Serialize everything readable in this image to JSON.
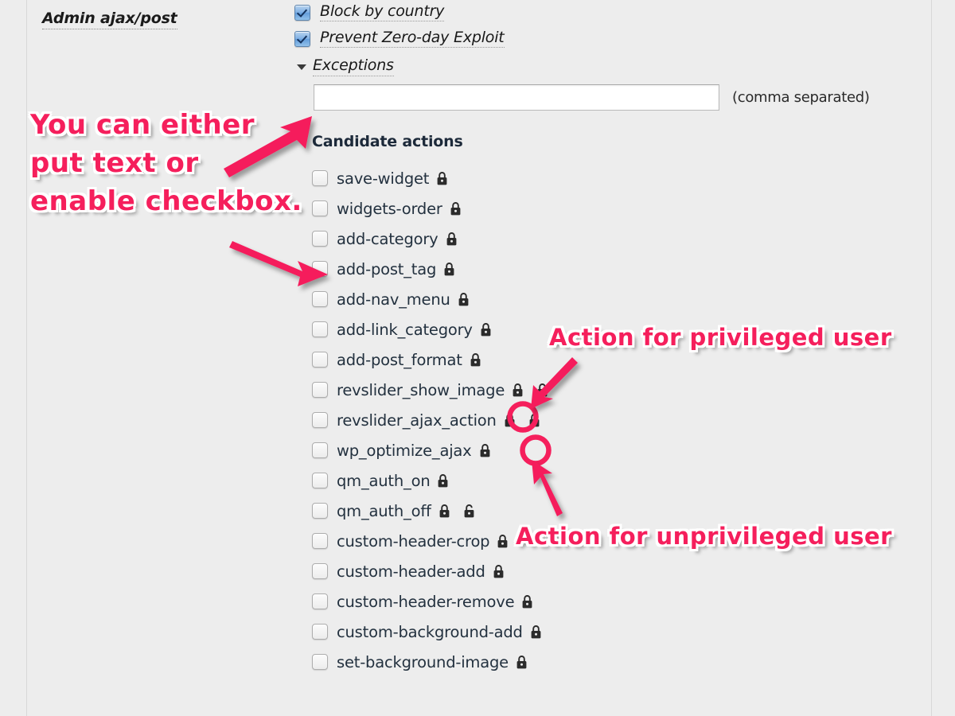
{
  "section": {
    "row_label": "Admin ajax/post"
  },
  "toggles": [
    {
      "label": "Block by country",
      "checked": true,
      "icon": "checkbox-checked-icon"
    },
    {
      "label": "Prevent Zero-day Exploit",
      "checked": true,
      "icon": "checkbox-checked-icon"
    }
  ],
  "exceptions": {
    "disclosure_icon": "triangle-down-icon",
    "label": "Exceptions",
    "value": "",
    "placeholder": "",
    "hint": "(comma separated)"
  },
  "candidate_actions": {
    "heading": "Candidate actions",
    "items": [
      {
        "label": "save-widget",
        "checked": false,
        "locks": [
          "closed"
        ]
      },
      {
        "label": "widgets-order",
        "checked": false,
        "locks": [
          "closed"
        ]
      },
      {
        "label": "add-category",
        "checked": false,
        "locks": [
          "closed"
        ]
      },
      {
        "label": "add-post_tag",
        "checked": false,
        "locks": [
          "closed"
        ]
      },
      {
        "label": "add-nav_menu",
        "checked": false,
        "locks": [
          "closed"
        ]
      },
      {
        "label": "add-link_category",
        "checked": false,
        "locks": [
          "closed"
        ]
      },
      {
        "label": "add-post_format",
        "checked": false,
        "locks": [
          "closed"
        ]
      },
      {
        "label": "revslider_show_image",
        "checked": false,
        "locks": [
          "closed",
          "open"
        ]
      },
      {
        "label": "revslider_ajax_action",
        "checked": false,
        "locks": [
          "closed",
          "open"
        ]
      },
      {
        "label": "wp_optimize_ajax",
        "checked": false,
        "locks": [
          "closed"
        ]
      },
      {
        "label": "qm_auth_on",
        "checked": false,
        "locks": [
          "closed"
        ]
      },
      {
        "label": "qm_auth_off",
        "checked": false,
        "locks": [
          "closed",
          "open"
        ]
      },
      {
        "label": "custom-header-crop",
        "checked": false,
        "locks": [
          "closed"
        ]
      },
      {
        "label": "custom-header-add",
        "checked": false,
        "locks": [
          "closed"
        ]
      },
      {
        "label": "custom-header-remove",
        "checked": false,
        "locks": [
          "closed"
        ]
      },
      {
        "label": "custom-background-add",
        "checked": false,
        "locks": [
          "closed"
        ]
      },
      {
        "label": "set-background-image",
        "checked": false,
        "locks": [
          "closed"
        ]
      }
    ]
  },
  "annotations": {
    "accent_color": "#f51f5c",
    "you_can_either": "You can either\nput text or\nenable checkbox.",
    "you_can_either_lines": [
      "You can either",
      "put text or",
      "enable checkbox."
    ],
    "privileged": "Action for privileged user",
    "unprivileged": "Action for unprivileged user"
  },
  "colors": {
    "background": "#ededed",
    "accent": "#f51f5c",
    "text": "#23313f",
    "checkbox_checked": "#6aa3de",
    "input_background": "#ffffff"
  }
}
